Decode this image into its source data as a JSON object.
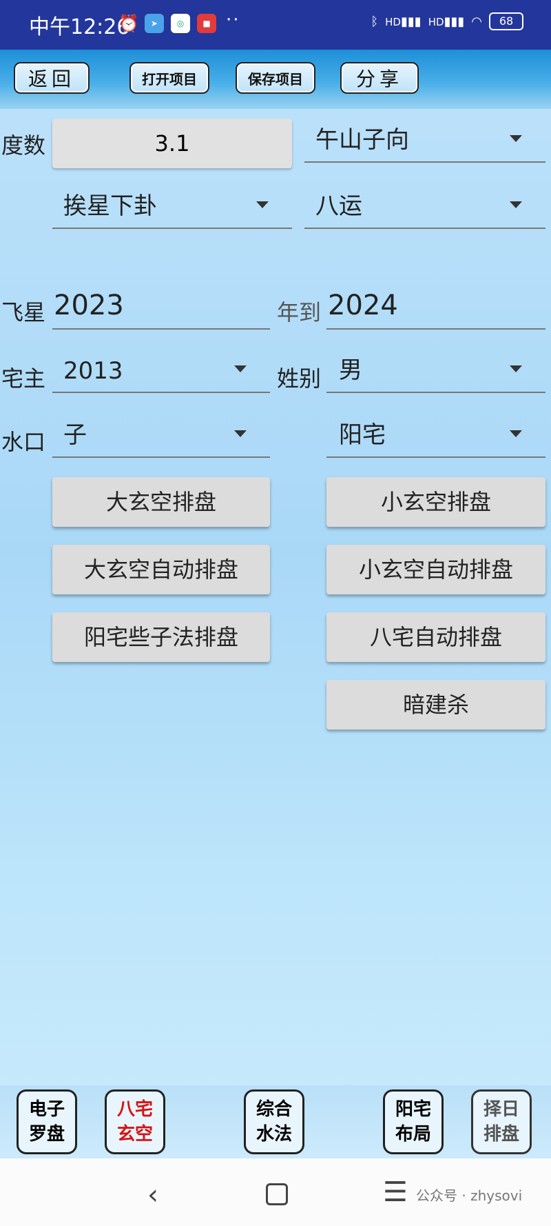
{
  "status_bar": {
    "time": "中午12:26",
    "dots": "··",
    "battery": "68",
    "hd1": "HD",
    "hd2": "HD"
  },
  "toolbar": {
    "back": "返回",
    "open_project": "打开项目",
    "save_project": "保存项目",
    "share": "分享"
  },
  "form": {
    "degree_label": "度数",
    "degree_value": "3.1",
    "mountain_direction": "午山子向",
    "method": "挨星下卦",
    "period": "八运",
    "flying_star_label": "飞星",
    "year_from": "2023",
    "to_label": "年到",
    "year_to": "2024",
    "owner_label": "宅主",
    "owner_year": "2013",
    "gender_label": "姓别",
    "gender_value": "男",
    "water_label": "水口",
    "water_value": "子",
    "house_type": "阳宅"
  },
  "actions": {
    "big_xuankong": "大玄空排盘",
    "small_xuankong": "小玄空排盘",
    "big_auto": "大玄空自动排盘",
    "small_auto": "小玄空自动排盘",
    "yangzhai_method": "阳宅些子法排盘",
    "bazhai_auto": "八宅自动排盘",
    "anjiansha": "暗建杀"
  },
  "bottom_nav": [
    {
      "line1": "电子",
      "line2": "罗盘"
    },
    {
      "line1": "八宅",
      "line2": "玄空"
    },
    {
      "line1": "综合",
      "line2": "水法"
    },
    {
      "line1": "阳宅",
      "line2": "布局"
    },
    {
      "line1": "择日",
      "line2": "排盘"
    }
  ],
  "system_nav": {
    "back": "‹",
    "menu": "☰",
    "watermark": "公众号 · zhysovi"
  },
  "colors": {
    "status_bar": "#23369c",
    "active_tab_text": "#d41414"
  }
}
